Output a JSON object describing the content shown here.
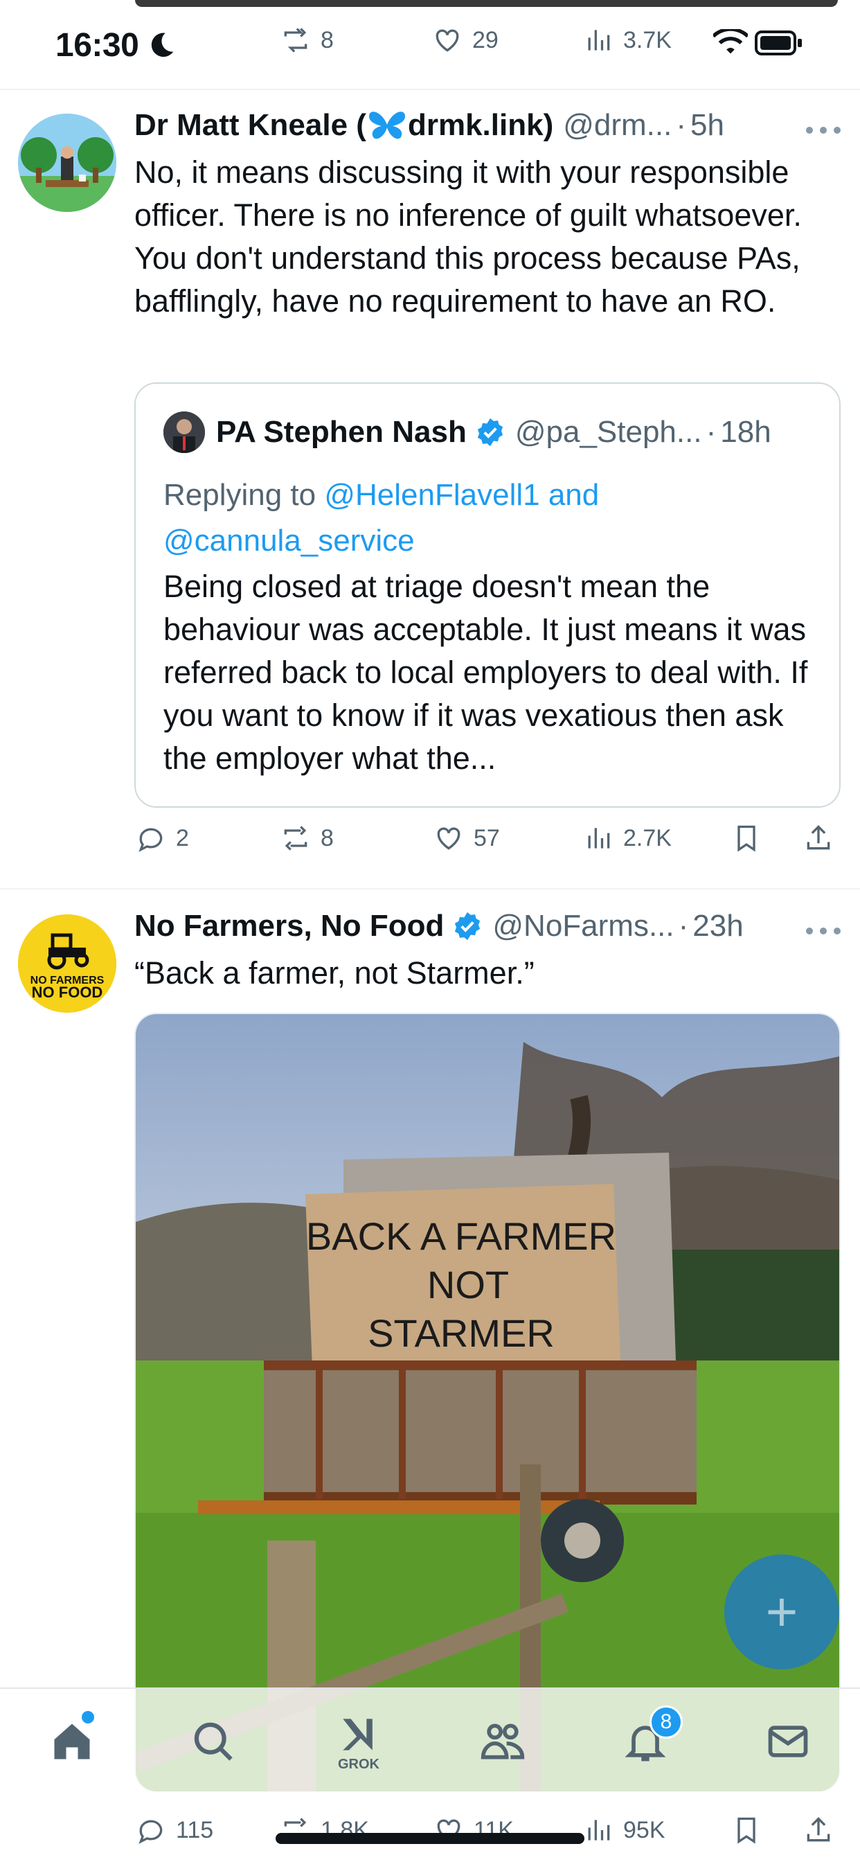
{
  "status_bar": {
    "time": "16:30"
  },
  "top_actions": {
    "retweets": "8",
    "likes": "29",
    "views": "3.7K"
  },
  "tweet1": {
    "name": "Dr Matt Kneale (",
    "name_suffix": "drmk.link)",
    "handle": "@drm...",
    "dot": "·",
    "time": "5h",
    "text": "No, it means discussing it with your responsible officer. There is no inference of guilt whatsoever. You don't understand this process because PAs, bafflingly, have no requirement to have an RO.",
    "quote": {
      "name": "PA Stephen Nash",
      "handle": "@pa_Steph...",
      "dot": "·",
      "time": "18h",
      "replying_prefix": "Replying to ",
      "replying_to_1": "@HelenFlavell1",
      "and": " and ",
      "replying_to_2": "@cannula_service",
      "text": "Being closed at triage doesn't mean the behaviour was acceptable. It just means it was referred back to local employers to deal with. If you want to know if it was vexatious then ask the employer what the..."
    },
    "actions": {
      "replies": "2",
      "retweets": "8",
      "likes": "57",
      "views": "2.7K"
    }
  },
  "tweet2": {
    "name": "No Farmers, No Food",
    "handle": "@NoFarms...",
    "dot": "·",
    "time": "23h",
    "text": "“Back a farmer, not Starmer.”",
    "avatar_text_1": "NO FARMERS",
    "avatar_text_2": "NO FOOD",
    "photo_sign_1": "BACK A FARMER",
    "photo_sign_2": "NOT",
    "photo_sign_3": "STARMER",
    "actions": {
      "replies": "115",
      "retweets": "1.8K",
      "likes": "11K",
      "views": "95K"
    }
  },
  "nav": {
    "grok_label": "GROK",
    "notifications_badge": "8"
  },
  "colors": {
    "accent": "#1d9bf0",
    "muted": "#536471",
    "text": "#0f1419"
  }
}
